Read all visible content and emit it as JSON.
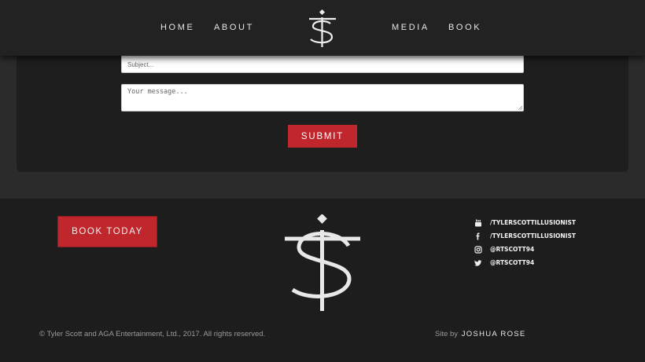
{
  "nav": {
    "items": [
      {
        "label": "HOME"
      },
      {
        "label": "ABOUT"
      },
      {
        "label": "MEDIA"
      },
      {
        "label": "BOOK"
      }
    ]
  },
  "form": {
    "subject_placeholder": "Subject...",
    "message_placeholder": "Your message...",
    "submit_label": "SUBMIT"
  },
  "footer": {
    "book_button": "BOOK TODAY",
    "social": [
      {
        "icon": "youtube-icon",
        "label": "/TYLERSCOTTILLUSIONIST"
      },
      {
        "icon": "facebook-icon",
        "label": "/TYLERSCOTTILLUSIONIST"
      },
      {
        "icon": "instagram-icon",
        "label": "@RTSCOTT94"
      },
      {
        "icon": "twitter-icon",
        "label": "@RTSCOTT94"
      }
    ],
    "copyright": "© Tyler Scott and AGA Entertainment, Ltd., 2017. All rights reserved.",
    "credit_prefix": "Site by",
    "credit_author": "JOSHUA ROSE"
  },
  "colors": {
    "accent": "#c0272d",
    "nav_bg": "#222222",
    "footer_bg": "#1d1d1d",
    "panel_bg": "#1e1e1e"
  }
}
